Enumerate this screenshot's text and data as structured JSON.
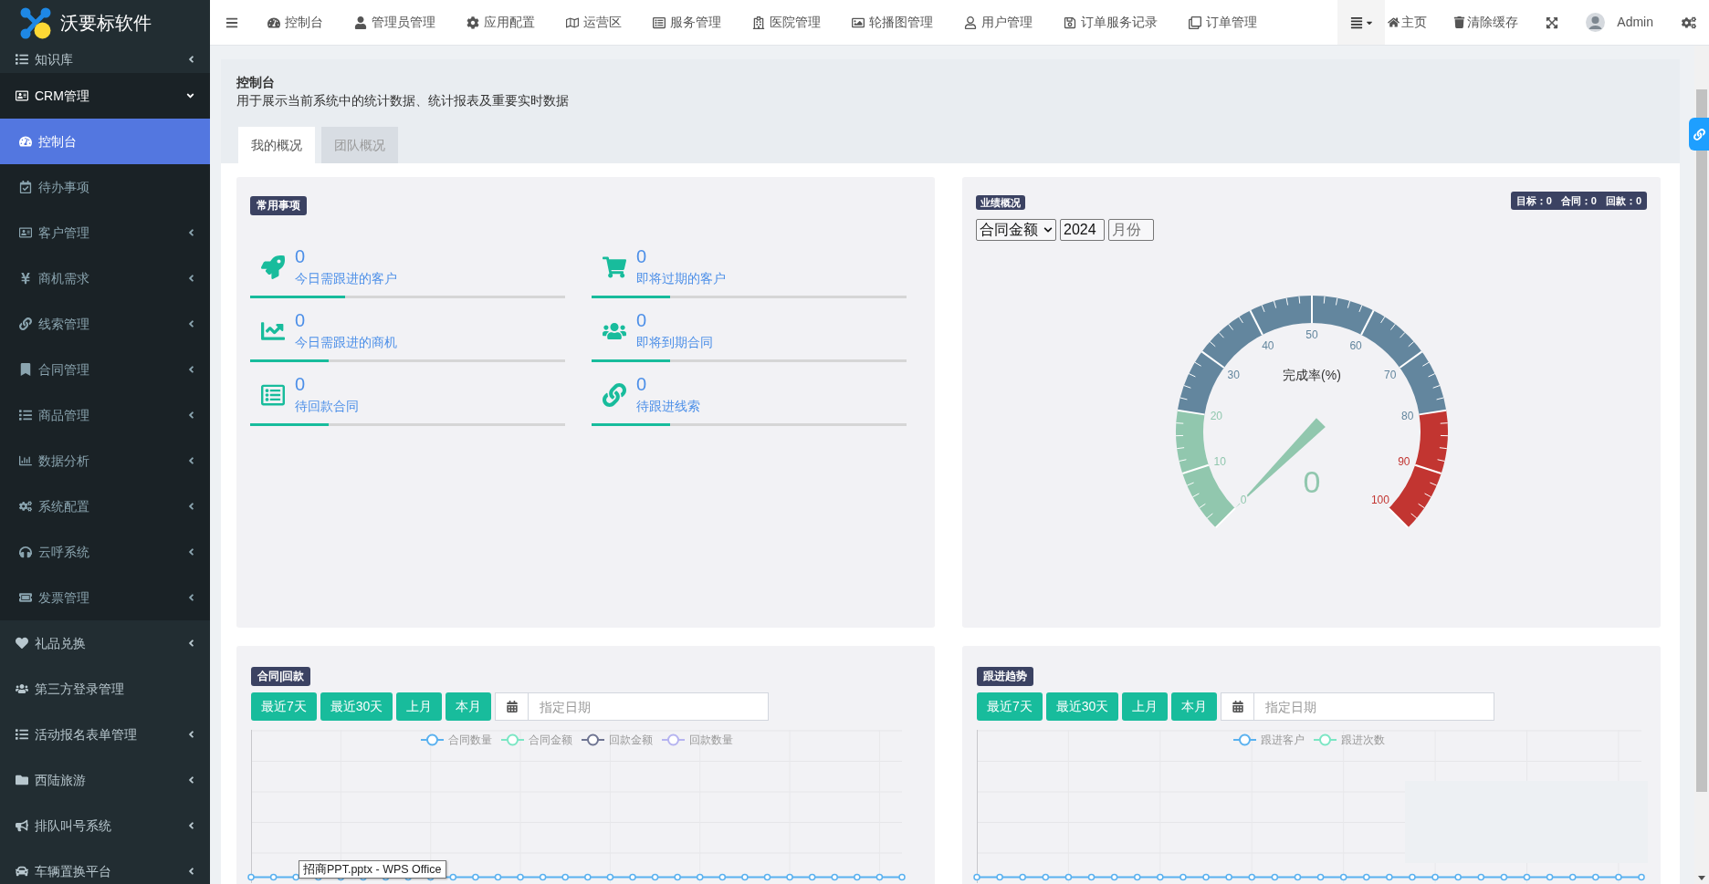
{
  "logo": {
    "text": "沃要标软件"
  },
  "sidebar": {
    "items": [
      {
        "kind": "menu",
        "label": "知识库",
        "expanded": false,
        "selected": false
      },
      {
        "kind": "menu",
        "label": "CRM管理",
        "expanded": true,
        "selected": false,
        "children": [
          {
            "kind": "link",
            "label": "控制台",
            "selected": true
          },
          {
            "kind": "link",
            "label": "待办事项",
            "selected": false
          },
          {
            "kind": "menu",
            "label": "客户管理",
            "expanded": false,
            "selected": false
          },
          {
            "kind": "menu",
            "label": "商机需求",
            "expanded": false,
            "selected": false
          },
          {
            "kind": "menu",
            "label": "线索管理",
            "expanded": false,
            "selected": false
          },
          {
            "kind": "menu",
            "label": "合同管理",
            "expanded": false,
            "selected": false
          },
          {
            "kind": "menu",
            "label": "商品管理",
            "expanded": false,
            "selected": false
          },
          {
            "kind": "menu",
            "label": "数据分析",
            "expanded": false,
            "selected": false
          },
          {
            "kind": "menu",
            "label": "系统配置",
            "expanded": false,
            "selected": false
          },
          {
            "kind": "menu",
            "label": "云呼系统",
            "expanded": false,
            "selected": false
          },
          {
            "kind": "menu",
            "label": "发票管理",
            "expanded": false,
            "selected": false
          }
        ]
      },
      {
        "kind": "menu",
        "label": "礼品兑换",
        "expanded": false,
        "selected": false
      },
      {
        "kind": "link",
        "label": "第三方登录管理",
        "selected": false
      },
      {
        "kind": "menu",
        "label": "活动报名表单管理",
        "expanded": false,
        "selected": false
      },
      {
        "kind": "menu",
        "label": "西陆旅游",
        "expanded": false,
        "selected": false
      },
      {
        "kind": "menu",
        "label": "排队叫号系统",
        "expanded": false,
        "selected": false
      },
      {
        "kind": "menu",
        "label": "车辆置换平台",
        "expanded": false,
        "selected": false
      }
    ]
  },
  "top_nav": {
    "items": [
      {
        "label": "控制台"
      },
      {
        "label": "管理员管理"
      },
      {
        "label": "应用配置"
      },
      {
        "label": "运营区"
      },
      {
        "label": "服务管理"
      },
      {
        "label": "医院管理"
      },
      {
        "label": "轮播图管理"
      },
      {
        "label": "用户管理"
      },
      {
        "label": "订单服务记录"
      },
      {
        "label": "订单管理"
      }
    ],
    "right_items": [
      {
        "label": "主页"
      },
      {
        "label": "清除缓存"
      }
    ],
    "user": {
      "name": "Admin"
    }
  },
  "page_header": {
    "title": "控制台",
    "description": "用于展示当前系统中的统计数据、统计报表及重要实时数据"
  },
  "tabs": [
    {
      "label": "我的概况",
      "selected": true
    },
    {
      "label": "团队概况",
      "selected": false
    }
  ],
  "common_items": {
    "badge": "常用事项",
    "items": [
      {
        "count": "0",
        "label": "今日需跟进的客户",
        "level": 0.3
      },
      {
        "count": "0",
        "label": "即将过期的客户",
        "level": 0.25
      },
      {
        "count": "0",
        "label": "今日需跟进的商机",
        "level": 0.25
      },
      {
        "count": "0",
        "label": "即将到期合同",
        "level": 0.25
      },
      {
        "count": "0",
        "label": "待回款合同",
        "level": 0.25
      },
      {
        "count": "0",
        "label": "待跟进线索",
        "level": 0.25
      }
    ]
  },
  "performance": {
    "badge": "业绩概况",
    "totals": [
      "目标：0",
      "合同：0",
      "回款：0"
    ],
    "type_select": {
      "value": "合同金额"
    },
    "year_input": {
      "value": "2024"
    },
    "month_input": {
      "placeholder": "月份"
    },
    "gauge": {
      "title": "完成率(%)",
      "value": "0",
      "scale_labels": [
        "0",
        "10",
        "20",
        "30",
        "40",
        "50",
        "60",
        "70",
        "80",
        "90",
        "100"
      ]
    }
  },
  "contract_chart": {
    "badge": "合同|回款",
    "buttons": [
      "最近7天",
      "最近30天",
      "上月",
      "本月"
    ],
    "date_input": {
      "placeholder": "指定日期"
    },
    "legend": [
      {
        "name": "合同数量",
        "color": "#5ab1ef"
      },
      {
        "name": "合同金额",
        "color": "#7be6c4"
      },
      {
        "name": "回款金额",
        "color": "#6f7592"
      },
      {
        "name": "回款数量",
        "color": "#b6b4f0"
      }
    ]
  },
  "follow_chart": {
    "badge": "跟进趋势",
    "buttons": [
      "最近7天",
      "最近30天",
      "上月",
      "本月"
    ],
    "date_input": {
      "placeholder": "指定日期"
    },
    "legend": [
      {
        "name": "跟进客户",
        "color": "#5ab1ef"
      },
      {
        "name": "跟进次数",
        "color": "#7be6c4"
      }
    ]
  },
  "taskbar_tooltip": {
    "text": "招商PPT.pptx - WPS Office"
  }
}
